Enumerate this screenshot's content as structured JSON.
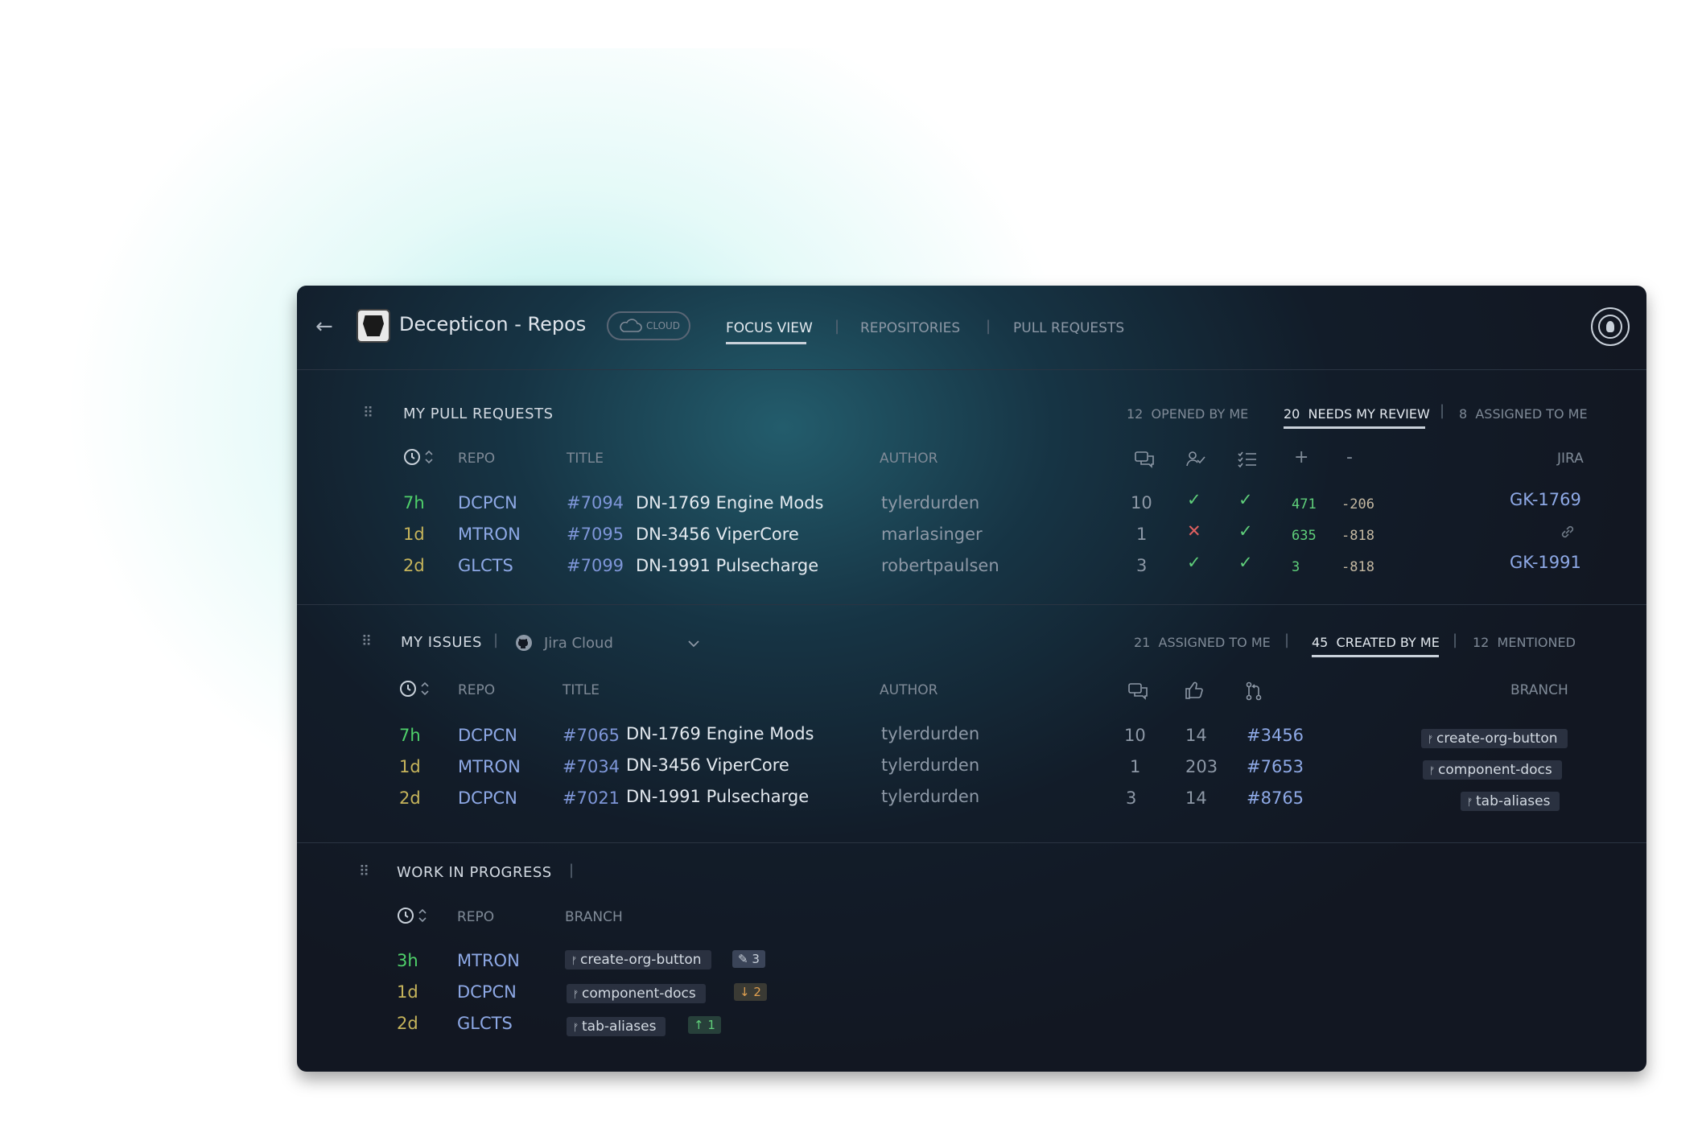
{
  "header": {
    "title": "Decepticon - Repos",
    "cloud_label": "CLOUD",
    "tabs": [
      {
        "label": "FOCUS VIEW",
        "active": true
      },
      {
        "label": "REPOSITORIES",
        "active": false
      },
      {
        "label": "PULL REQUESTS",
        "active": false
      }
    ]
  },
  "pull_requests": {
    "title": "MY PULL REQUESTS",
    "filters": [
      {
        "count": "12",
        "label": "OPENED BY ME",
        "active": false
      },
      {
        "count": "20",
        "label": "NEEDS MY REVIEW",
        "active": true
      },
      {
        "count": "8",
        "label": "ASSIGNED TO ME",
        "active": false
      }
    ],
    "columns": {
      "repo": "REPO",
      "title": "TITLE",
      "author": "AUTHOR",
      "plus": "+",
      "minus": "-",
      "jira": "JIRA"
    },
    "rows": [
      {
        "age": "7h",
        "repo": "DCPCN",
        "number": "#7094",
        "title": "DN-1769 Engine Mods",
        "author": "tylerdurden",
        "comments": "10",
        "approved": "check",
        "checks": "check",
        "added": "471",
        "removed": "-206",
        "jira": "GK-1769"
      },
      {
        "age": "1d",
        "repo": "MTRON",
        "number": "#7095",
        "title": "DN-3456 ViperCore",
        "author": "marlasinger",
        "comments": "1",
        "approved": "x",
        "checks": "check",
        "added": "635",
        "removed": "-818",
        "jira": ""
      },
      {
        "age": "2d",
        "repo": "GLCTS",
        "number": "#7099",
        "title": "DN-1991 Pulsecharge",
        "author": "robertpaulsen",
        "comments": "3",
        "approved": "check",
        "checks": "check",
        "added": "3",
        "removed": "-818",
        "jira": "GK-1991"
      }
    ]
  },
  "issues": {
    "title": "MY ISSUES",
    "source": "Jira Cloud",
    "filters": [
      {
        "count": "21",
        "label": "ASSIGNED TO ME",
        "active": false
      },
      {
        "count": "45",
        "label": "CREATED BY ME",
        "active": true
      },
      {
        "count": "12",
        "label": "MENTIONED",
        "active": false
      }
    ],
    "columns": {
      "repo": "REPO",
      "title": "TITLE",
      "author": "AUTHOR",
      "branch": "BRANCH"
    },
    "rows": [
      {
        "age": "7h",
        "repo": "DCPCN",
        "number": "#7065",
        "title": "DN-1769 Engine Mods",
        "author": "tylerdurden",
        "comments": "10",
        "likes": "14",
        "pr": "#3456",
        "branch": "create-org-button"
      },
      {
        "age": "1d",
        "repo": "MTRON",
        "number": "#7034",
        "title": "DN-3456 ViperCore",
        "author": "tylerdurden",
        "comments": "1",
        "likes": "203",
        "pr": "#7653",
        "branch": "component-docs"
      },
      {
        "age": "2d",
        "repo": "DCPCN",
        "number": "#7021",
        "title": "DN-1991 Pulsecharge",
        "author": "tylerdurden",
        "comments": "3",
        "likes": "14",
        "pr": "#8765",
        "branch": "tab-aliases"
      }
    ]
  },
  "wip": {
    "title": "WORK IN PROGRESS",
    "columns": {
      "repo": "REPO",
      "branch": "BRANCH"
    },
    "rows": [
      {
        "age": "3h",
        "repo": "MTRON",
        "branch": "create-org-button",
        "badge": "3",
        "badge_kind": "edit"
      },
      {
        "age": "1d",
        "repo": "DCPCN",
        "branch": "component-docs",
        "badge": "2",
        "badge_kind": "behind"
      },
      {
        "age": "2d",
        "repo": "GLCTS",
        "branch": "tab-aliases",
        "badge": "1",
        "badge_kind": "ahead"
      }
    ]
  },
  "colors": {
    "accent_green": "#4fd16a",
    "accent_yellow": "#c6b45b",
    "link_blue": "#8ea9e6",
    "error_red": "#e06060"
  }
}
